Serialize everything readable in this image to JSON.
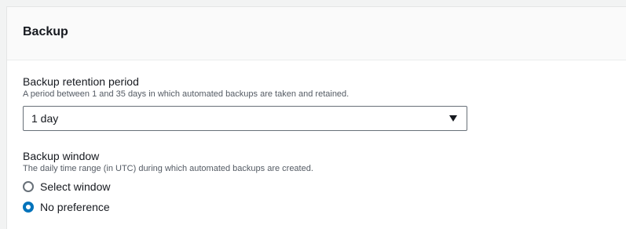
{
  "panel": {
    "title": "Backup"
  },
  "retention": {
    "label": "Backup retention period",
    "description": "A period between 1 and 35 days in which automated backups are taken and retained.",
    "selected_value": "1 day",
    "icon": "caret-down-icon"
  },
  "window": {
    "label": "Backup window",
    "description": "The daily time range (in UTC) during which automated backups are created.",
    "options": [
      {
        "label": "Select window",
        "checked": false
      },
      {
        "label": "No preference",
        "checked": true
      }
    ]
  },
  "colors": {
    "accent": "#0073bb",
    "panel_header_bg": "#fafafa",
    "page_bg": "#f2f3f3"
  }
}
